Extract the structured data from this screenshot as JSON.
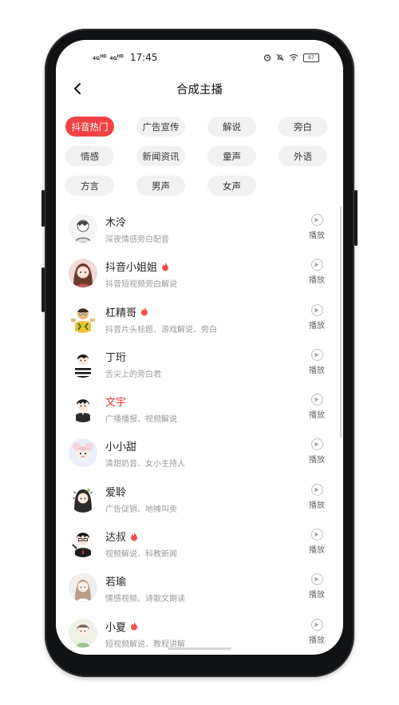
{
  "status": {
    "net1": "4G",
    "net1_sup": "HD",
    "net2": "4G",
    "net2_sup": "HD",
    "time": "17:45",
    "battery": "67"
  },
  "header": {
    "title": "合成主播"
  },
  "categories": [
    {
      "label": "抖音热门",
      "active": true
    },
    {
      "label": "广告宣传"
    },
    {
      "label": "解说"
    },
    {
      "label": "旁白"
    },
    {
      "label": "情感"
    },
    {
      "label": "新闻资讯"
    },
    {
      "label": "童声"
    },
    {
      "label": "外语"
    },
    {
      "label": "方言"
    },
    {
      "label": "男声"
    },
    {
      "label": "女声"
    }
  ],
  "play_label": "播放",
  "colors": {
    "accent": "#f04246",
    "selected_name": "#e2342f"
  },
  "anchors": [
    {
      "name": "木泠",
      "desc": "深夜情感旁白配音",
      "hot": false
    },
    {
      "name": "抖音小姐姐",
      "desc": "抖音短视频旁白解说",
      "hot": true
    },
    {
      "name": "杠精哥",
      "desc": "抖音片头标题、游戏解说、旁白",
      "hot": true
    },
    {
      "name": "丁珩",
      "desc": "舌尖上的旁白君",
      "hot": false
    },
    {
      "name": "文宇",
      "desc": "广播播报、视频解说",
      "hot": false,
      "selected": true
    },
    {
      "name": "小小甜",
      "desc": "清甜奶音、女小主持人",
      "hot": false
    },
    {
      "name": "爱聆",
      "desc": "广告促销、地摊叫卖",
      "hot": false
    },
    {
      "name": "达叔",
      "desc": "视频解说、科教新闻",
      "hot": true
    },
    {
      "name": "若瑜",
      "desc": "情感视频、诗歌文朗读",
      "hot": false
    },
    {
      "name": "小夏",
      "desc": "短视频解说、教程讲解",
      "hot": true
    }
  ]
}
